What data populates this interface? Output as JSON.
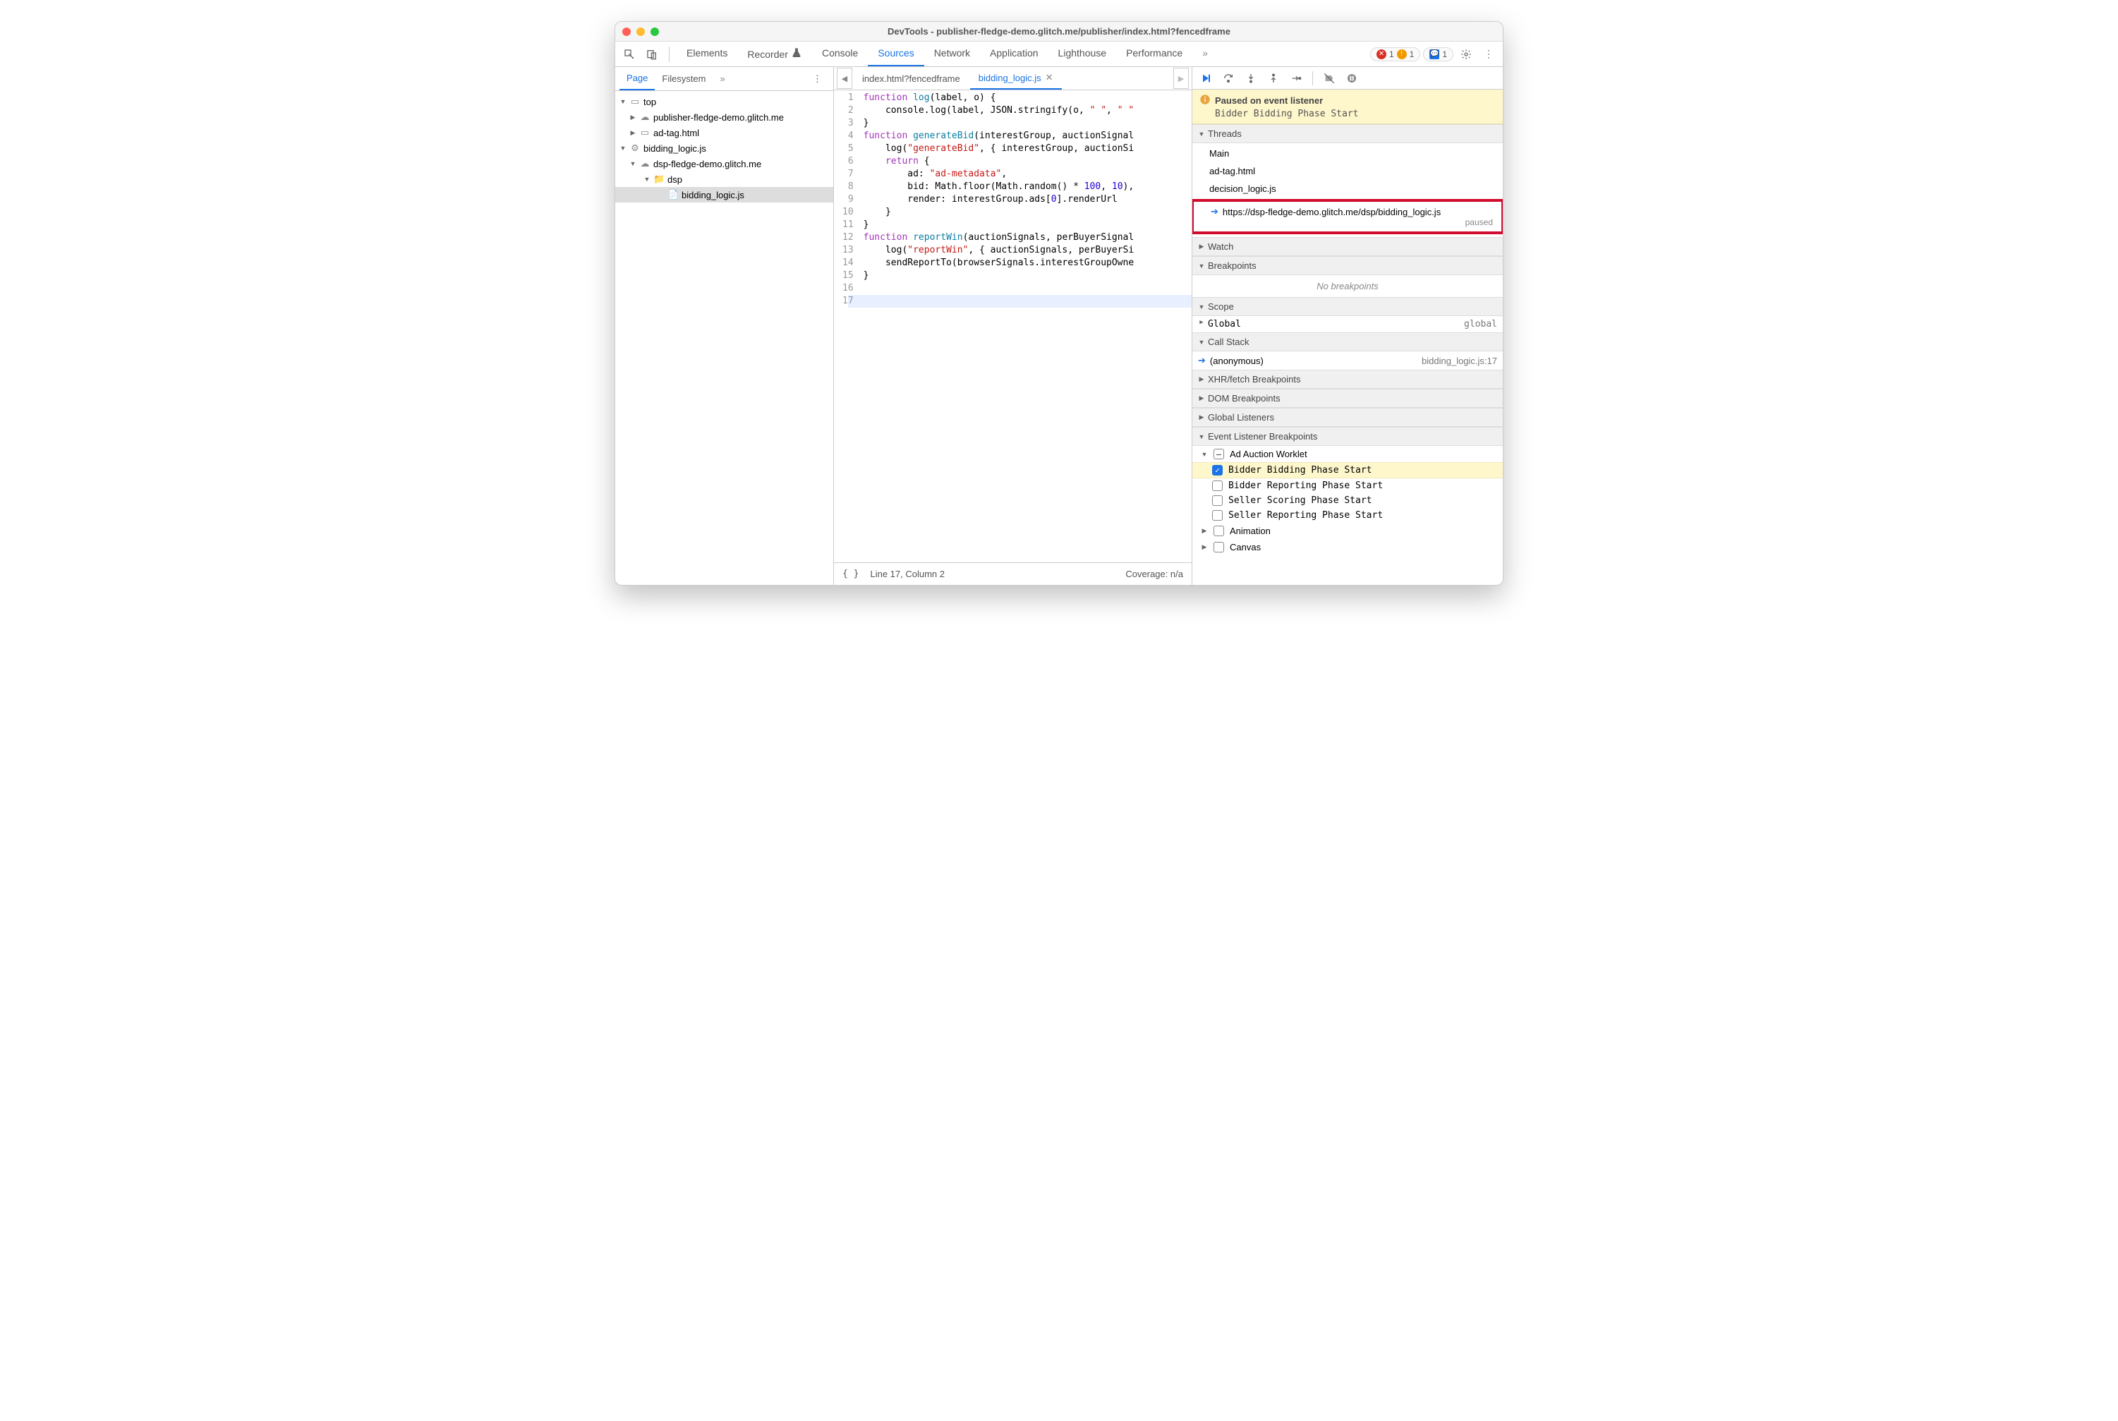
{
  "window": {
    "title": "DevTools - publisher-fledge-demo.glitch.me/publisher/index.html?fencedframe"
  },
  "toolbar": {
    "errors": "1",
    "warnings": "1",
    "messages": "1",
    "more_icon": "»"
  },
  "mainTabs": [
    "Elements",
    "Recorder",
    "Console",
    "Sources",
    "Network",
    "Application",
    "Lighthouse",
    "Performance"
  ],
  "mainTabsActive": "Sources",
  "leftTabs": {
    "items": [
      "Page",
      "Filesystem"
    ],
    "active": "Page",
    "more": "»"
  },
  "tree": {
    "top": "top",
    "pub": "publisher-fledge-demo.glitch.me",
    "adtag": "ad-tag.html",
    "bidding_worklet": "bidding_logic.js",
    "dsp_origin": "dsp-fledge-demo.glitch.me",
    "dsp_folder": "dsp",
    "bidding_file": "bidding_logic.js"
  },
  "fileTabs": {
    "items": [
      {
        "label": "index.html?fencedframe",
        "active": false,
        "closeable": false
      },
      {
        "label": "bidding_logic.js",
        "active": true,
        "closeable": true
      }
    ]
  },
  "code": {
    "lines": [
      [
        [
          "kw",
          "function"
        ],
        null,
        [
          "id",
          "log"
        ],
        [
          "",
          "(label, o) {"
        ]
      ],
      [
        [
          "",
          "    console.log(label, JSON.stringify(o, "
        ],
        [
          "str",
          "\" \""
        ],
        [
          "",
          ", "
        ],
        [
          "str",
          "\" \""
        ]
      ],
      [
        [
          "",
          "}"
        ]
      ],
      [
        [
          "",
          ""
        ]
      ],
      [
        [
          "kw",
          "function"
        ],
        null,
        [
          "id",
          "generateBid"
        ],
        [
          "",
          "(interestGroup, auctionSignal"
        ]
      ],
      [
        [
          "",
          "    log("
        ],
        [
          "str",
          "\"generateBid\""
        ],
        [
          "",
          ", { interestGroup, auctionSi"
        ]
      ],
      [
        [
          "",
          "    "
        ],
        [
          "kw",
          "return"
        ],
        [
          "",
          " {"
        ]
      ],
      [
        [
          "",
          "        ad: "
        ],
        [
          "str",
          "\"ad-metadata\""
        ],
        [
          "",
          ","
        ]
      ],
      [
        [
          "",
          "        bid: Math.floor(Math.random() * "
        ],
        [
          "num",
          "100"
        ],
        [
          "",
          ", "
        ],
        [
          "num",
          "10"
        ],
        [
          "",
          "),"
        ]
      ],
      [
        [
          "",
          "        render: interestGroup.ads["
        ],
        [
          "num",
          "0"
        ],
        [
          "",
          "].renderUrl"
        ]
      ],
      [
        [
          "",
          "    }"
        ]
      ],
      [
        [
          "",
          "}"
        ]
      ],
      [
        [
          "",
          ""
        ]
      ],
      [
        [
          "kw",
          "function"
        ],
        null,
        [
          "id",
          "reportWin"
        ],
        [
          "",
          "(auctionSignals, perBuyerSignal"
        ]
      ],
      [
        [
          "",
          "    log("
        ],
        [
          "str",
          "\"reportWin\""
        ],
        [
          "",
          ", { auctionSignals, perBuyerSi"
        ]
      ],
      [
        [
          "",
          "    sendReportTo(browserSignals.interestGroupOwne"
        ]
      ],
      [
        [
          "",
          "}"
        ]
      ]
    ],
    "highlightLine": 17
  },
  "statusbar": {
    "pos": "Line 17, Column 2",
    "coverage": "Coverage: n/a"
  },
  "debugger": {
    "banner": {
      "title": "Paused on event listener",
      "detail": "Bidder Bidding Phase Start"
    },
    "threads": {
      "header": "Threads",
      "items": [
        "Main",
        "ad-tag.html",
        "decision_logic.js"
      ],
      "current": {
        "url": "https://dsp-fledge-demo.glitch.me/dsp/bidding_logic.js",
        "status": "paused"
      }
    },
    "watch": "Watch",
    "breakpoints": {
      "header": "Breakpoints",
      "empty": "No breakpoints"
    },
    "scope": {
      "header": "Scope",
      "global": "Global",
      "globalVal": "global"
    },
    "callstack": {
      "header": "Call Stack",
      "frame": "(anonymous)",
      "loc": "bidding_logic.js:17"
    },
    "xhr": "XHR/fetch Breakpoints",
    "dombp": "DOM Breakpoints",
    "gl": "Global Listeners",
    "elb": {
      "header": "Event Listener Breakpoints",
      "group": "Ad Auction Worklet",
      "items": [
        {
          "label": "Bidder Bidding Phase Start",
          "checked": true
        },
        {
          "label": "Bidder Reporting Phase Start",
          "checked": false
        },
        {
          "label": "Seller Scoring Phase Start",
          "checked": false
        },
        {
          "label": "Seller Reporting Phase Start",
          "checked": false
        }
      ],
      "anim": "Animation",
      "canvas": "Canvas"
    }
  }
}
